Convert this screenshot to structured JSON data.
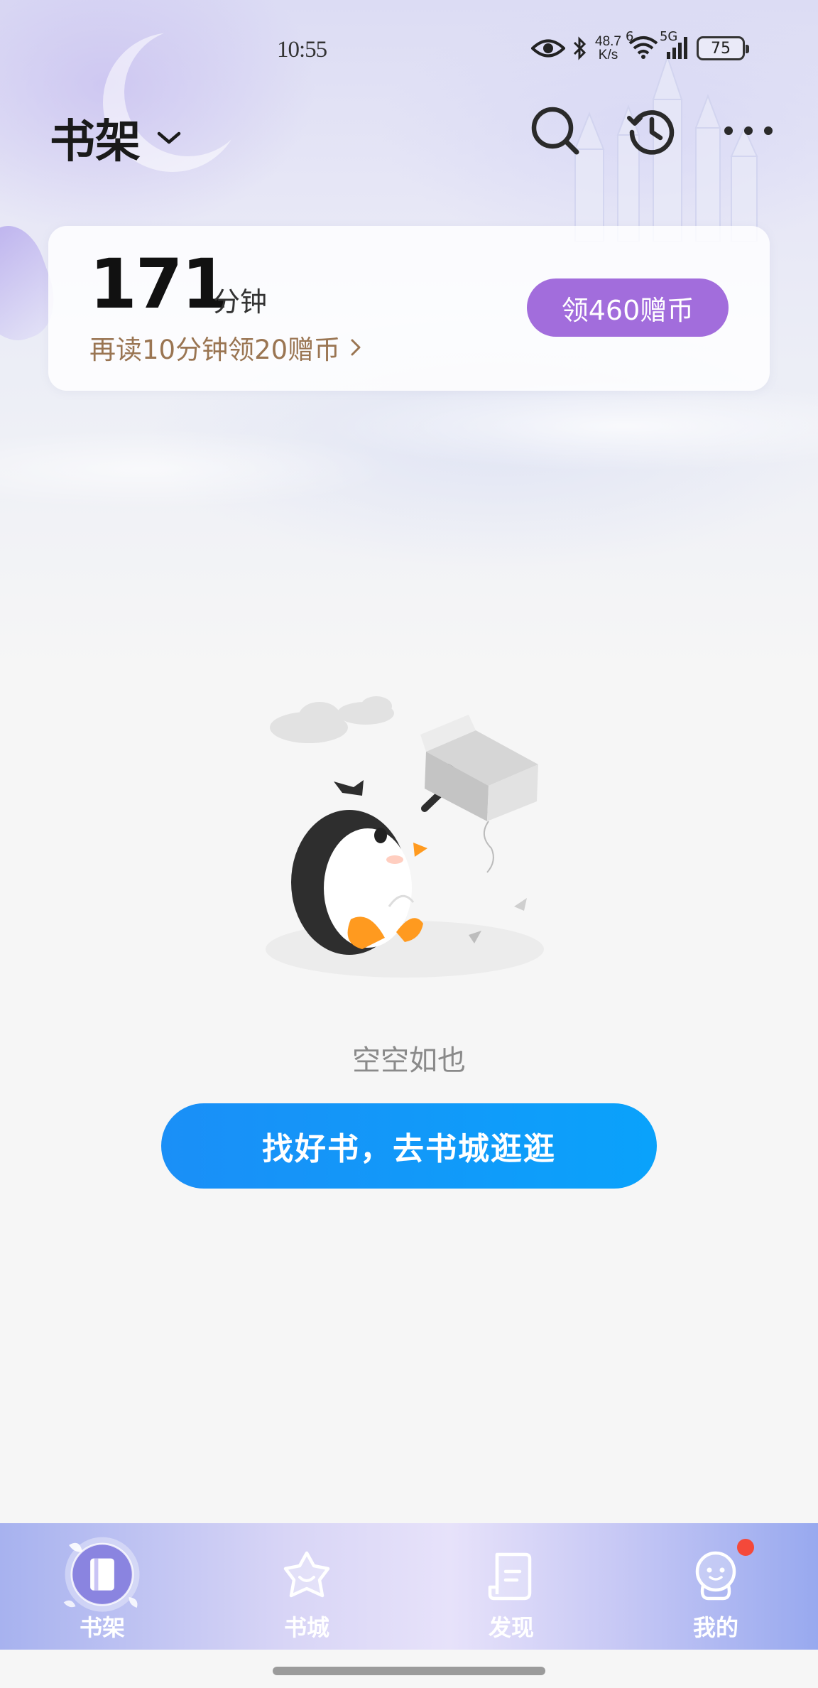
{
  "status_bar": {
    "time": "10:55",
    "net_speed_value": "48.7",
    "net_speed_unit": "K/s",
    "wifi_label": "6",
    "cell_label": "5G",
    "battery": "75"
  },
  "header": {
    "title": "书架"
  },
  "reading_card": {
    "minutes": "171",
    "minutes_unit": "分钟",
    "hint": "再读10分钟领20赠币",
    "reward_button": "领460赠币"
  },
  "empty_state": {
    "text": "空空如也",
    "button": "找好书，去书城逛逛"
  },
  "bottom_nav": {
    "items": [
      {
        "label": "书架",
        "icon": "bookshelf-icon",
        "active": true
      },
      {
        "label": "书城",
        "icon": "bookstore-icon",
        "active": false
      },
      {
        "label": "发现",
        "icon": "discover-icon",
        "active": false
      },
      {
        "label": "我的",
        "icon": "profile-icon",
        "active": false,
        "badge": true
      }
    ]
  },
  "colors": {
    "accent_purple": "#a26ddc",
    "accent_blue": "#0c9cfa",
    "hint_brown": "#9a7552",
    "badge_red": "#f4493a"
  }
}
